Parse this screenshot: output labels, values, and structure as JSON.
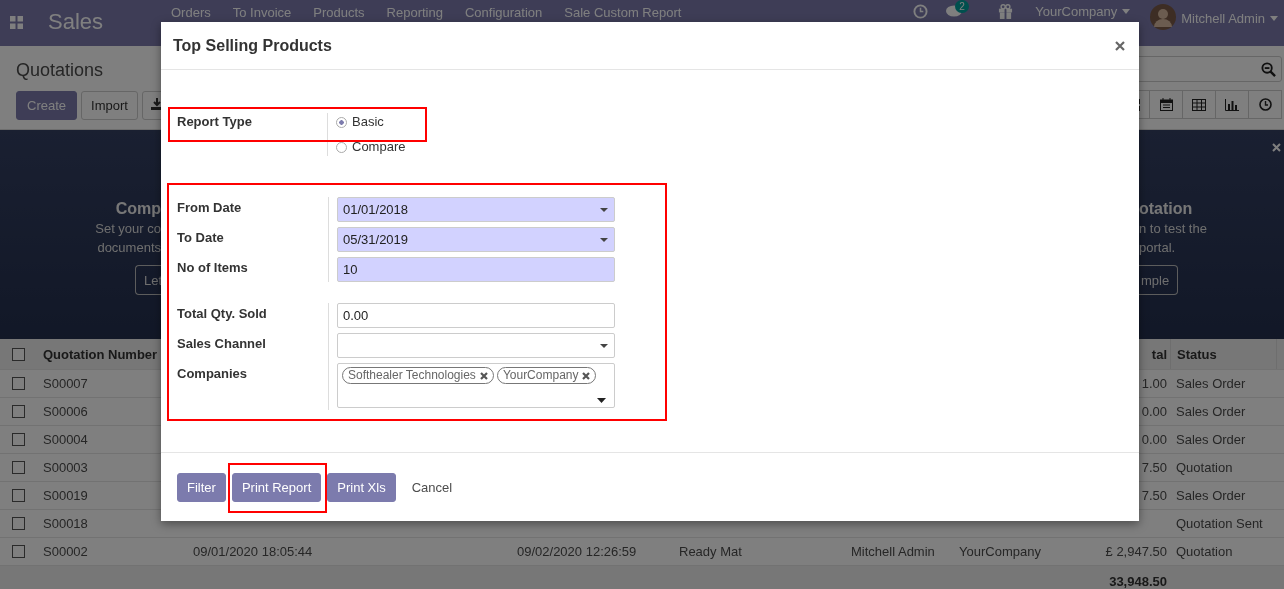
{
  "navbar": {
    "app_name": "Sales",
    "menu": [
      "Orders",
      "To Invoice",
      "Products",
      "Reporting",
      "Configuration",
      "Sale Custom Report"
    ],
    "messages_badge": "2",
    "company": "YourCompany",
    "user": "Mitchell Admin"
  },
  "control_panel": {
    "title": "Quotations",
    "buttons": [
      "Create",
      "Import"
    ]
  },
  "banner": {
    "left": {
      "heading": "Comp",
      "lines": [
        "Set your co",
        "documents"
      ],
      "button": "Let"
    },
    "right": {
      "heading": "otation",
      "lines": [
        "n to test the",
        "portal."
      ],
      "button": "mple"
    }
  },
  "table": {
    "header_checked": false,
    "columns": [
      "Quotation Number",
      "tal",
      "Status"
    ],
    "rows": [
      {
        "checked": false,
        "number": "S00007",
        "total": "1.00",
        "status": "Sales Order"
      },
      {
        "checked": false,
        "number": "S00006",
        "total": "0.00",
        "status": "Sales Order"
      },
      {
        "checked": false,
        "number": "S00004",
        "total": "0.00",
        "status": "Sales Order"
      },
      {
        "checked": false,
        "number": "S00003",
        "total": "7.50",
        "status": "Quotation"
      },
      {
        "checked": false,
        "number": "S00019",
        "total": "7.50",
        "status": "Sales Order"
      },
      {
        "checked": false,
        "number": "S00018",
        "status": "Quotation Sent"
      },
      {
        "checked": false,
        "number": "S00002",
        "date": "09/01/2020 18:05:44",
        "expected": "09/02/2020 12:26:59",
        "customer": "Ready Mat",
        "salesperson": "Mitchell Admin",
        "company": "YourCompany",
        "total": "£ 2,947.50",
        "status": "Quotation"
      }
    ],
    "sum": "33,948.50"
  },
  "dialog": {
    "title": "Top Selling Products",
    "report_type": {
      "label": "Report Type",
      "highlighted": true,
      "options": [
        {
          "label": "Basic",
          "selected": true
        },
        {
          "label": "Compare",
          "selected": false
        }
      ]
    },
    "highlighted_fields": true,
    "field_groups": [
      [
        {
          "label": "From Date",
          "kind": "date",
          "value": "01/01/2018",
          "required": true
        },
        {
          "label": "To Date",
          "kind": "date",
          "value": "05/31/2019",
          "required": true
        },
        {
          "label": "No of Items",
          "kind": "text",
          "value": "10",
          "required": true
        }
      ],
      [
        {
          "label": "Total Qty. Sold",
          "kind": "text",
          "value": "0.00",
          "required": false
        },
        {
          "label": "Sales Channel",
          "kind": "select",
          "required": false
        },
        {
          "label": "Companies",
          "kind": "tags",
          "tags": [
            "Softhealer Technologies",
            "YourCompany"
          ],
          "required": false
        }
      ]
    ],
    "buttons": [
      {
        "label": "Filter",
        "kind": "primary",
        "highlighted": false
      },
      {
        "label": "Print Report",
        "kind": "primary",
        "highlighted": true
      },
      {
        "label": "Print Xls",
        "kind": "primary",
        "highlighted": false
      },
      {
        "label": "Cancel",
        "kind": "link",
        "highlighted": false
      }
    ]
  }
}
